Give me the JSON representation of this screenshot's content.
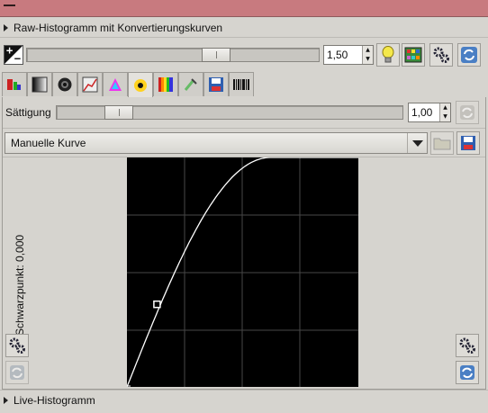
{
  "titlebar": {
    "color": "#c87a7f"
  },
  "sections": {
    "top_title": "Raw-Histogramm mit Konvertierungskurven",
    "bottom_title": "Live-Histogramm"
  },
  "exposure": {
    "slider_value": 0.67,
    "spin_value": "1,50",
    "icons": [
      "exposure-toggle-icon",
      "bulb-icon",
      "color-chart-icon",
      "gears-icon",
      "refresh-icon"
    ]
  },
  "tools": {
    "tabs": [
      "red-channel-icon",
      "gray-gradient-icon",
      "lens-icon",
      "histogram-curve-icon",
      "color-triangle-icon",
      "saturation-spot-icon",
      "spectrum-icon",
      "brush-icon",
      "save-curve-icon",
      "barcode-icon"
    ],
    "active_index": 5
  },
  "saturation": {
    "label": "Sättigung",
    "slider_value": 0.15,
    "spin_value": "1,00"
  },
  "curve": {
    "mode_label": "Manuelle Kurve",
    "blackpoint_label": "Schwarzpunkt: 0,000",
    "control_point": {
      "x": 0.13,
      "y": 0.36
    }
  },
  "colors": {
    "background": "#d6d4cf",
    "graph_bg": "#000000",
    "curve": "#ffffff",
    "grid": "#404040"
  }
}
